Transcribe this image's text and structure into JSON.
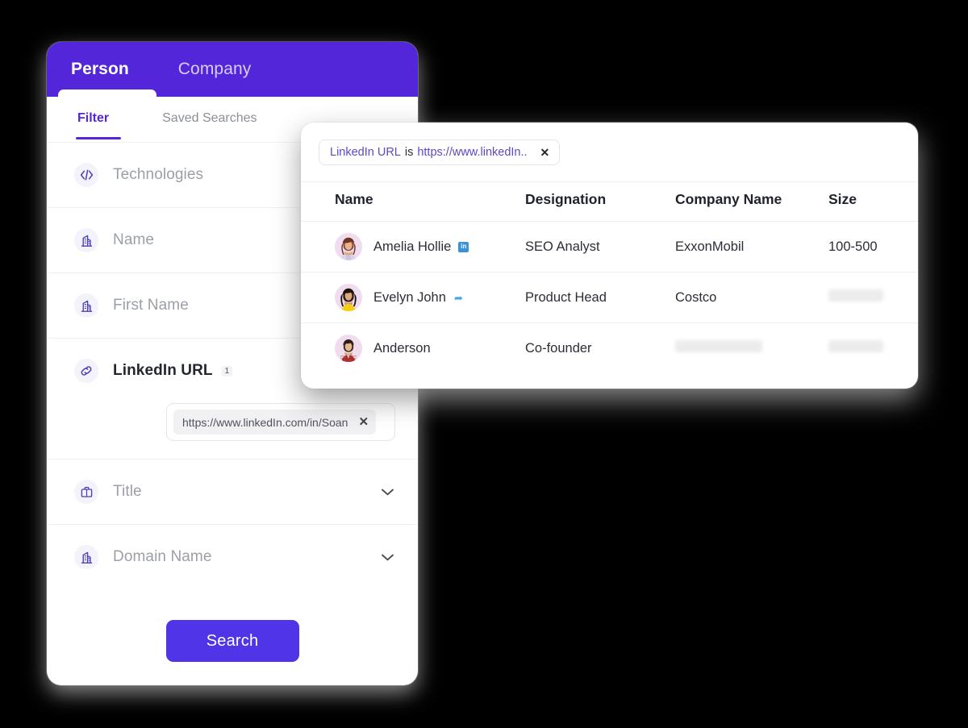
{
  "filter_panel": {
    "header_tabs": [
      {
        "label": "Person",
        "active": true
      },
      {
        "label": "Company",
        "active": false
      }
    ],
    "sub_tabs": [
      {
        "label": "Filter",
        "active": true
      },
      {
        "label": "Saved Searches",
        "active": false
      }
    ],
    "filters": [
      {
        "label": "Technologies",
        "icon": "code-icon",
        "selected": false,
        "count": "",
        "chevron": false
      },
      {
        "label": "Name",
        "icon": "building-icon",
        "selected": false,
        "count": "",
        "chevron": false
      },
      {
        "label": "First Name",
        "icon": "building-icon",
        "selected": false,
        "count": "",
        "chevron": false
      },
      {
        "label": "LinkedIn URL",
        "icon": "link-icon",
        "selected": true,
        "count": "1",
        "chevron": false
      },
      {
        "label": "Title",
        "icon": "briefcase-icon",
        "selected": false,
        "count": "",
        "chevron": true
      },
      {
        "label": "Domain Name",
        "icon": "building-icon",
        "selected": false,
        "count": "",
        "chevron": true
      }
    ],
    "url_value": "https://www.linkedIn.com/in/Soan",
    "url_remove_label": "✕",
    "search_button": "Search"
  },
  "results_panel": {
    "applied_filter_chip": {
      "field": "LinkedIn URL",
      "operator": "is",
      "value": "https://www.linkedIn..",
      "remove_label": "✕"
    },
    "columns": [
      "Name",
      "Designation",
      "Company Name",
      "Size"
    ],
    "rows": [
      {
        "name": "Amelia Hollie",
        "social": "linkedin",
        "designation": "SEO Analyst",
        "company": "ExxonMobil",
        "size": "100-500",
        "company_redacted": false,
        "size_redacted": false
      },
      {
        "name": "Evelyn John",
        "social": "twitter",
        "designation": "Product Head",
        "company": "Costco",
        "size": "",
        "company_redacted": false,
        "size_redacted": true
      },
      {
        "name": "Anderson",
        "social": "",
        "designation": "Co-founder",
        "company": "",
        "size": "",
        "company_redacted": true,
        "size_redacted": true
      }
    ]
  },
  "colors": {
    "brand_purple": "#5426d9",
    "button_purple": "#4f34e8",
    "accent_link": "#5d49c6",
    "page_background": "#000000"
  }
}
